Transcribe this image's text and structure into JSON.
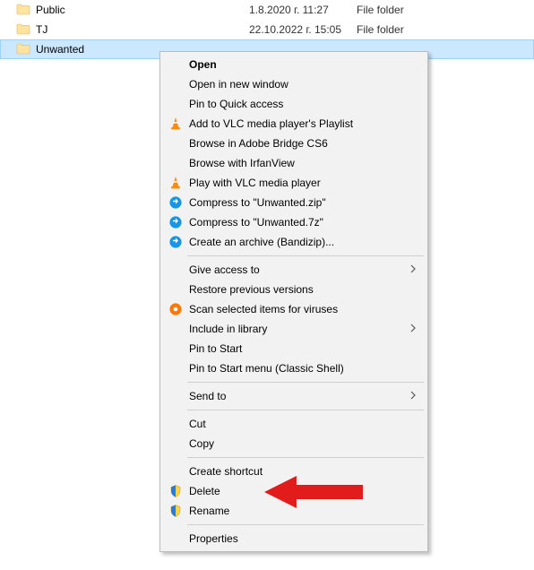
{
  "files": [
    {
      "name": "Public",
      "date": "1.8.2020 г. 11:27",
      "type": "File folder",
      "selected": false
    },
    {
      "name": "TJ",
      "date": "22.10.2022 г. 15:05",
      "type": "File folder",
      "selected": false
    },
    {
      "name": "Unwanted",
      "date": "",
      "type": "",
      "selected": true
    }
  ],
  "context_menu": [
    {
      "kind": "item",
      "label": "Open",
      "bold": true,
      "icon": null,
      "submenu": false
    },
    {
      "kind": "item",
      "label": "Open in new window",
      "icon": null,
      "submenu": false
    },
    {
      "kind": "item",
      "label": "Pin to Quick access",
      "icon": null,
      "submenu": false
    },
    {
      "kind": "item",
      "label": "Add to VLC media player's Playlist",
      "icon": "vlc",
      "submenu": false
    },
    {
      "kind": "item",
      "label": "Browse in Adobe Bridge CS6",
      "icon": null,
      "submenu": false
    },
    {
      "kind": "item",
      "label": "Browse with IrfanView",
      "icon": null,
      "submenu": false
    },
    {
      "kind": "item",
      "label": "Play with VLC media player",
      "icon": "vlc",
      "submenu": false
    },
    {
      "kind": "item",
      "label": "Compress to \"Unwanted.zip\"",
      "icon": "bandizip",
      "submenu": false
    },
    {
      "kind": "item",
      "label": "Compress to \"Unwanted.7z\"",
      "icon": "bandizip",
      "submenu": false
    },
    {
      "kind": "item",
      "label": "Create an archive (Bandizip)...",
      "icon": "bandizip",
      "submenu": false
    },
    {
      "kind": "sep"
    },
    {
      "kind": "item",
      "label": "Give access to",
      "icon": null,
      "submenu": true
    },
    {
      "kind": "item",
      "label": "Restore previous versions",
      "icon": null,
      "submenu": false
    },
    {
      "kind": "item",
      "label": "Scan selected items for viruses",
      "icon": "avast",
      "submenu": false
    },
    {
      "kind": "item",
      "label": "Include in library",
      "icon": null,
      "submenu": true
    },
    {
      "kind": "item",
      "label": "Pin to Start",
      "icon": null,
      "submenu": false
    },
    {
      "kind": "item",
      "label": "Pin to Start menu (Classic Shell)",
      "icon": null,
      "submenu": false
    },
    {
      "kind": "sep"
    },
    {
      "kind": "item",
      "label": "Send to",
      "icon": null,
      "submenu": true
    },
    {
      "kind": "sep"
    },
    {
      "kind": "item",
      "label": "Cut",
      "icon": null,
      "submenu": false
    },
    {
      "kind": "item",
      "label": "Copy",
      "icon": null,
      "submenu": false
    },
    {
      "kind": "sep"
    },
    {
      "kind": "item",
      "label": "Create shortcut",
      "icon": null,
      "submenu": false
    },
    {
      "kind": "item",
      "label": "Delete",
      "icon": "shield",
      "submenu": false
    },
    {
      "kind": "item",
      "label": "Rename",
      "icon": "shield",
      "submenu": false
    },
    {
      "kind": "sep"
    },
    {
      "kind": "item",
      "label": "Properties",
      "icon": null,
      "submenu": false
    }
  ],
  "callout": {
    "points_to": "Delete",
    "color": "#e21b1b"
  }
}
